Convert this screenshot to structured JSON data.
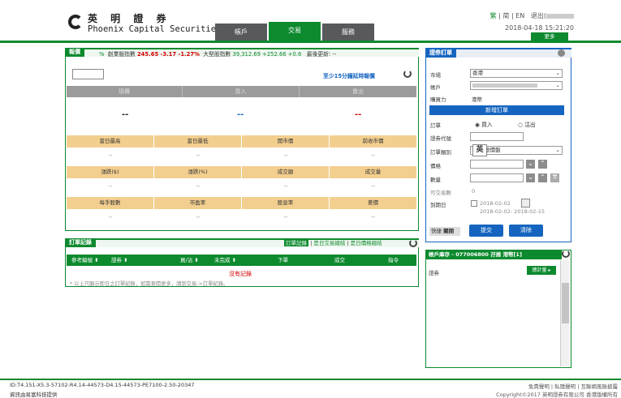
{
  "header": {
    "brand_cn": "英 明 證 券",
    "brand_en": "Phoenix Capital Securities",
    "lang_trad": "繁",
    "lang_simp": "简",
    "lang_en": "EN",
    "logout": "退出(",
    "datetime": "2018-04-18 15:21:20",
    "more": "更多",
    "nav": [
      "帳戶",
      "交易",
      "服務"
    ]
  },
  "quote": {
    "title": "報價",
    "ticker_prefix": "%",
    "idx1_label": "創業版指數",
    "idx1_vals": "245.65 -3.17 -1.27%",
    "idx2_label": "大型股指數",
    "idx2_vals": "39,312.69 +252.66 +0.6",
    "update_label": "最後更新: --",
    "delay_note": "至少15分鐘延時報價",
    "col_headers": [
      "現價",
      "買入",
      "賣出"
    ],
    "big_dashes": [
      "--",
      "--",
      "--"
    ],
    "row1": [
      "當日最高",
      "當日最低",
      "開市價",
      "前收市價"
    ],
    "row2": [
      "漲跌($)",
      "漲跌(%)",
      "成交額",
      "成交量"
    ],
    "row3": [
      "每手股數",
      "市盈率",
      "股息率",
      "差價"
    ],
    "dash": "--"
  },
  "orders": {
    "title": "訂單記錄",
    "link1": "訂單記錄",
    "link2": "是日交易總結",
    "link3": "是日價格總結",
    "cols": [
      "參考編號",
      "證券",
      "買/沽",
      "未完成",
      "下單",
      "成交",
      "指令"
    ],
    "empty": "沒有記錄",
    "note": "* 以上只顯示即日之訂單紀錄，如需查閱更多，請到交易->訂單紀錄。"
  },
  "order_form": {
    "title": "證券訂單",
    "market_label": "市場",
    "market_value": "香港",
    "account_label": "帳戶",
    "buying_power_label": "購買力",
    "buying_power_value": "港幣",
    "new_order": "新增訂單",
    "order_label": "訂單",
    "buy": "買入",
    "sell": "沽出",
    "code_label": "證券代號",
    "type_label": "訂單類別",
    "type_value": "限價盤",
    "ime_char": "英",
    "price_label": "價格",
    "qty_label": "數量",
    "tradable_label": "可交易數",
    "tradable_value": "0",
    "expiry_label": "到期日",
    "expiry_date": "2018-02-02",
    "expiry_range": "2018-02-02- 2018-02-15",
    "quick": "快捷",
    "close": "關閉",
    "submit": "提交",
    "clear": "清除"
  },
  "holdings": {
    "title": "帳戶庫存 - 077006800 孖展 港幣[1]",
    "col_security": "證券",
    "qty_btn": "總計量 ▸"
  },
  "footer": {
    "left1": "ID:T4.151-X5.3-57102-R4.14-44573-D4.15-44573-PE7100-2.50-20347",
    "left2": "資訊由易富科技提供",
    "right1": "免責聲明 | 私隱聲明 | 互聯網風險披露",
    "right2": "Copyright©2017 英明證券有限公司 香港版權所有"
  },
  "colors": {
    "brand_green": "#0d8a2e",
    "tan": "#f3cf8f",
    "header_gray": "#9b9b9b",
    "button_blue": "#1565c0",
    "down_red": "#d40000"
  }
}
